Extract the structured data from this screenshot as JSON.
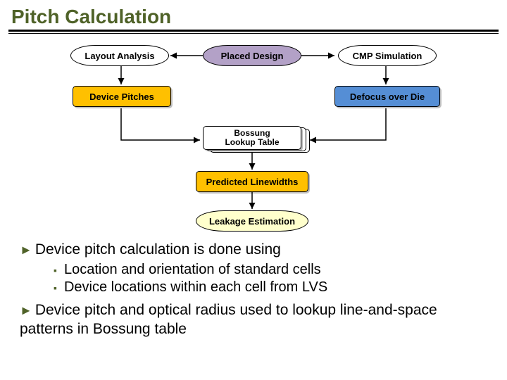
{
  "title": "Pitch Calculation",
  "diagram": {
    "layout_analysis": "Layout Analysis",
    "placed_design": "Placed Design",
    "cmp_simulation": "CMP Simulation",
    "device_pitches": "Device Pitches",
    "defocus_over_die": "Defocus over Die",
    "bossung_lookup_l1": "Bossung",
    "bossung_lookup_l2": "Lookup Table",
    "predicted_linewidths": "Predicted Linewidths",
    "leakage_estimation": "Leakage Estimation"
  },
  "bullets": {
    "b1": "Device pitch calculation is done using",
    "b1a": "Location and orientation of standard cells",
    "b1b": "Device locations within each cell from LVS",
    "b2": "Device pitch and optical radius used to lookup line-and-space patterns in Bossung table"
  }
}
